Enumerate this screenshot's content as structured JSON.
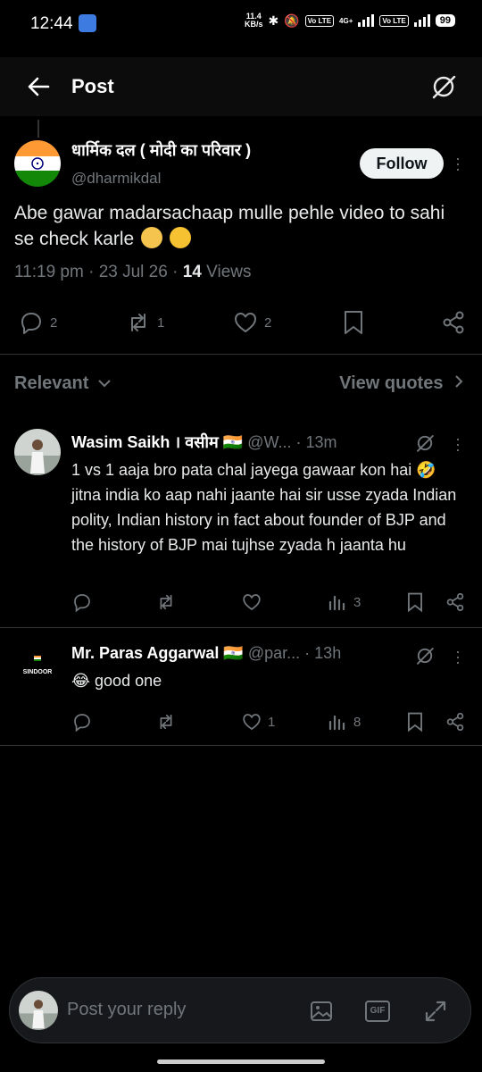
{
  "status_bar": {
    "time": "12:44",
    "speed_top": "11.4",
    "speed_unit": "KB/s",
    "network": "4G+",
    "volte1": "Vo LTE",
    "volte2": "Vo LTE",
    "battery": "99"
  },
  "header": {
    "title": "Post"
  },
  "post": {
    "author_name": "धार्मिक दल ( मोदी का परिवार )",
    "author_handle": "@dharmikdal",
    "follow_label": "Follow",
    "text": "Abe gawar madarsachaap mulle pehle video to sahi se check karle",
    "time": "11:19 pm",
    "date": "23 Jul 26",
    "views_count": "14",
    "views_label": "Views",
    "replies": "2",
    "reposts": "1",
    "likes": "2"
  },
  "sort": {
    "label": "Relevant",
    "quotes_label": "View quotes"
  },
  "replies": [
    {
      "name": "Wasim Saikh । वसीम 🇮🇳",
      "handle": "@W...",
      "time": "13m",
      "text": "1 vs 1 aaja bro pata chal jayega gawaar kon hai 🤣 jitna india ko aap nahi jaante hai sir usse zyada Indian polity, Indian history in fact about founder of BJP and the history of BJP mai tujhse zyada h jaanta hu",
      "replies": "",
      "reposts": "",
      "likes": "",
      "views": "3"
    },
    {
      "name": "Mr. Paras Aggarwal 🇮🇳",
      "handle": "@par...",
      "time": "13h",
      "text": "😂 good one",
      "replies": "",
      "reposts": "",
      "likes": "1",
      "views": "8",
      "avatar_text": "SINDOOR"
    }
  ],
  "reply_bar": {
    "placeholder": "Post your reply",
    "gif_label": "GIF"
  },
  "colors": {
    "background": "#000000",
    "muted": "#71767b",
    "text": "#e7e9ea",
    "divider": "#2f3336"
  }
}
